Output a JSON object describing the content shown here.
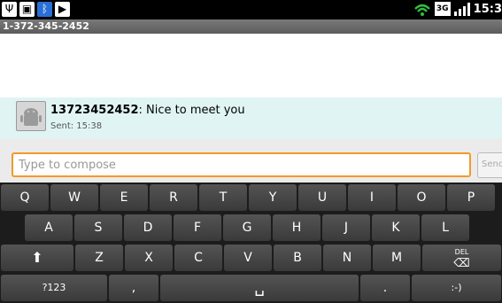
{
  "status_bar": {
    "time": "15:3",
    "network_type": "3G",
    "icons": [
      "usb-icon",
      "sd-card-icon",
      "bluetooth-icon",
      "play-icon",
      "wifi-icon",
      "signal-icon"
    ]
  },
  "title_bar": {
    "phone_number": "1-372-345-2452"
  },
  "messages": [
    {
      "sender": "13723452452",
      "separator": ":",
      "body": " Nice to meet you",
      "meta": "Sent: 15:38"
    }
  ],
  "compose": {
    "placeholder": "Type to compose",
    "send_label": "Send"
  },
  "keyboard": {
    "row1": [
      "Q",
      "W",
      "E",
      "R",
      "T",
      "Y",
      "U",
      "I",
      "O",
      "P"
    ],
    "row2": [
      "A",
      "S",
      "D",
      "F",
      "G",
      "H",
      "J",
      "K",
      "L"
    ],
    "row3": [
      "Z",
      "X",
      "C",
      "V",
      "B",
      "N",
      "M"
    ],
    "shift_symbol": "⬆",
    "delete_label": "DEL",
    "symbols_label": "?123",
    "comma": ",",
    "period": ".",
    "smiley": ":-)"
  },
  "colors": {
    "compose_border": "#f29a27",
    "message_bg": "#e0f4f4",
    "keyboard_bg": "#1c1c1c",
    "bluetooth": "#2a6fd6"
  }
}
